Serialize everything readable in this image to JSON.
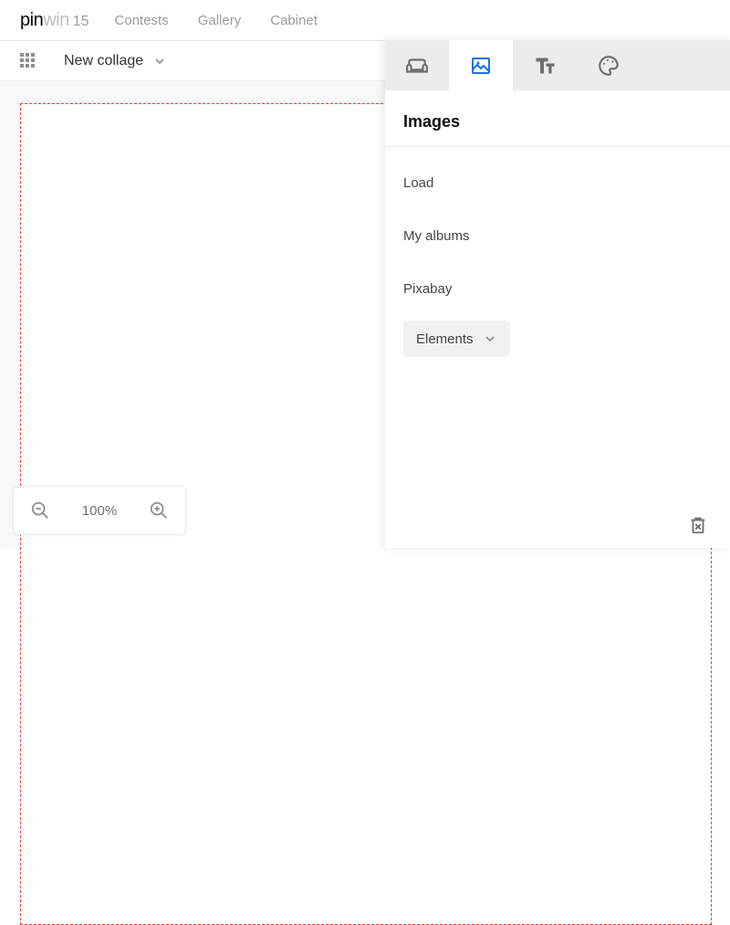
{
  "logo": {
    "pin": "pin",
    "win": "win",
    "version": "15"
  },
  "nav": {
    "contests": "Contests",
    "gallery": "Gallery",
    "cabinet": "Cabinet"
  },
  "doc": {
    "title": "New collage"
  },
  "zoom": {
    "level": "100%"
  },
  "panel": {
    "title": "Images",
    "items": {
      "load": "Load",
      "albums": "My albums",
      "pixabay": "Pixabay",
      "elements": "Elements"
    }
  }
}
